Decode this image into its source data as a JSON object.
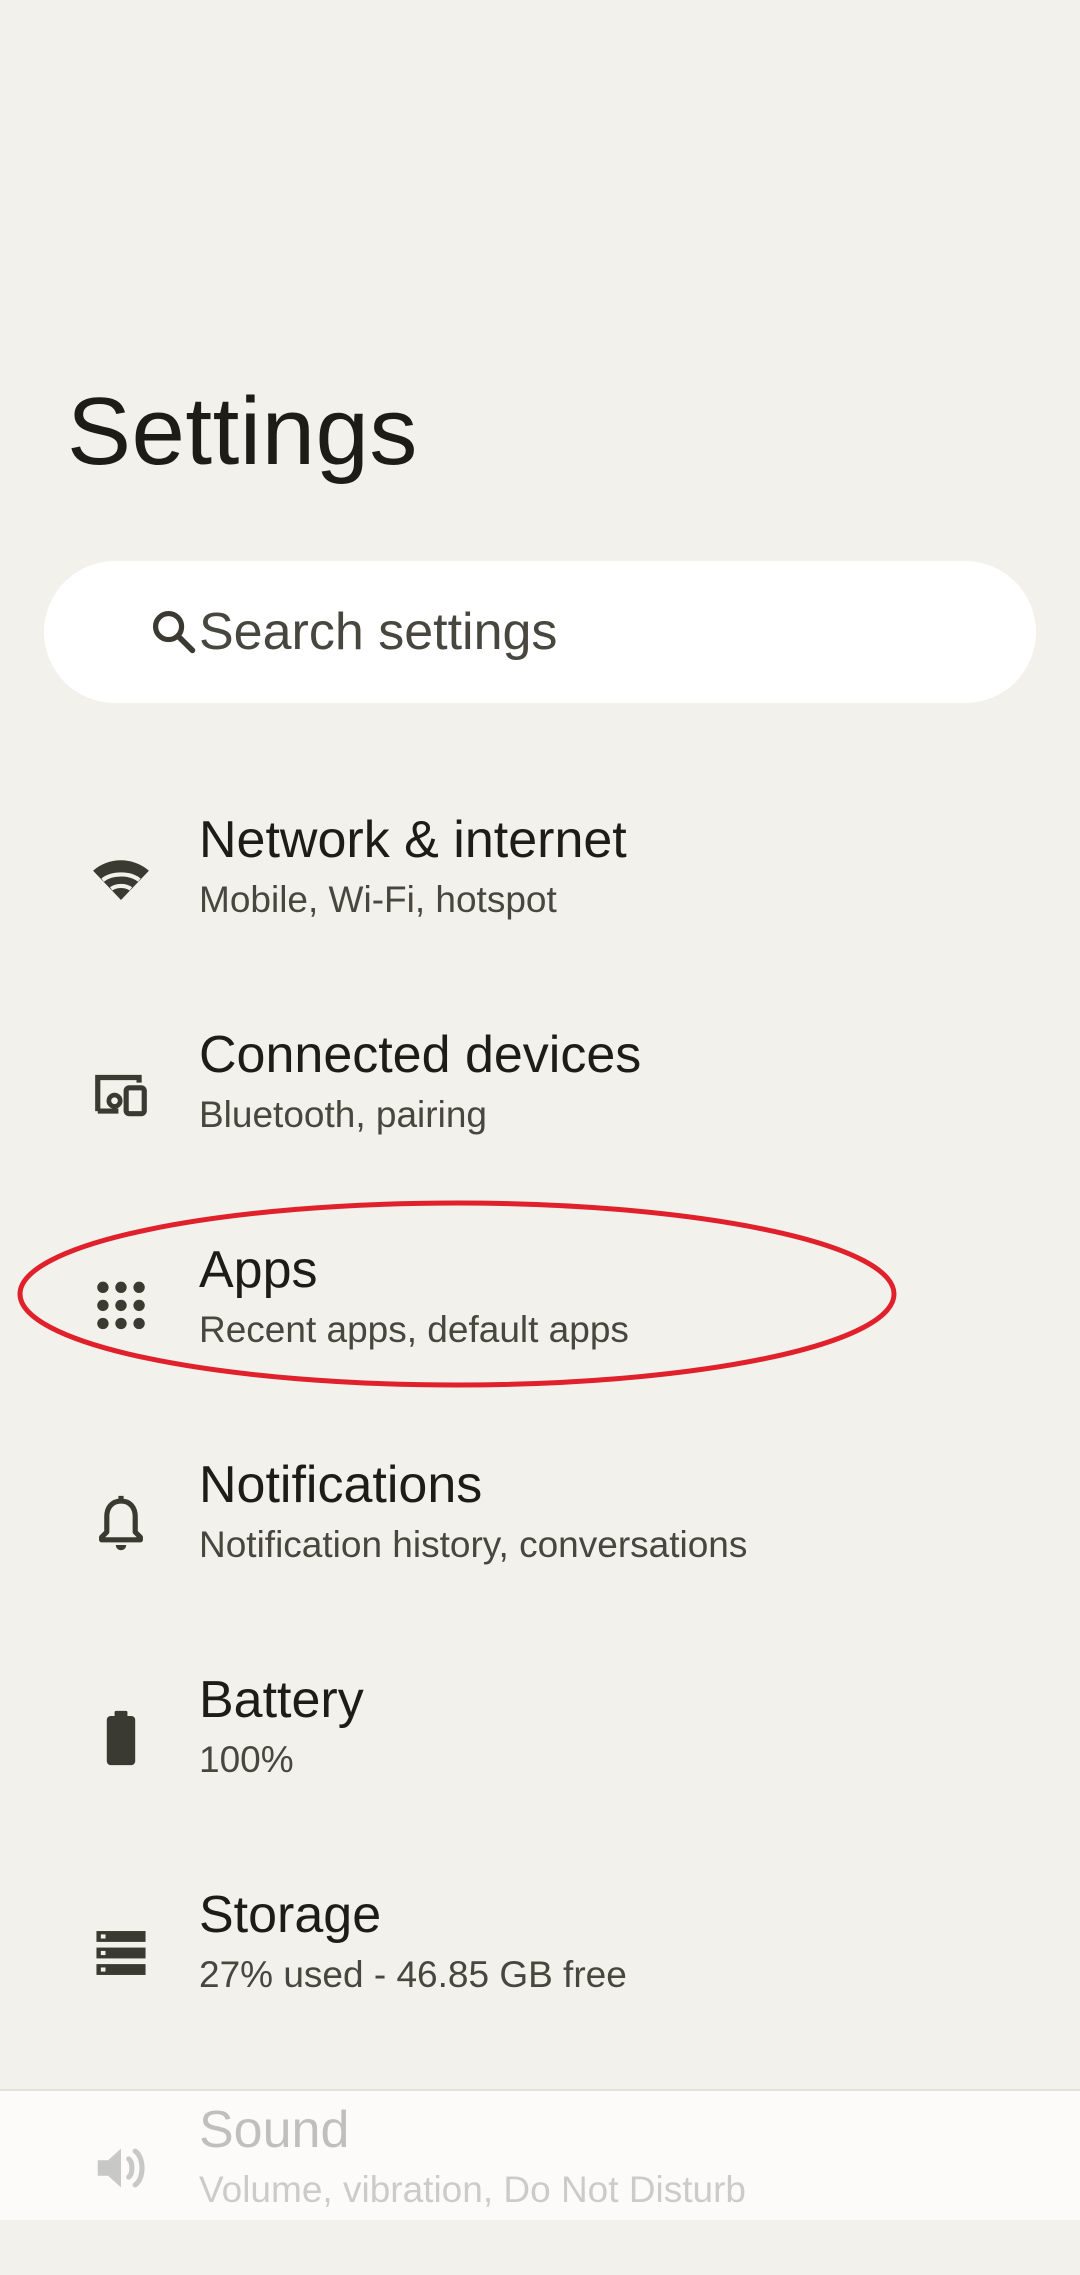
{
  "page": {
    "title": "Settings"
  },
  "search": {
    "placeholder": "Search settings",
    "icon": "search-icon"
  },
  "settings_items": [
    {
      "title": "Network & internet",
      "summary": "Mobile, Wi-Fi, hotspot",
      "icon": "wifi-icon"
    },
    {
      "title": "Connected devices",
      "summary": "Bluetooth, pairing",
      "icon": "connected-devices-icon"
    },
    {
      "title": "Apps",
      "summary": "Recent apps, default apps",
      "icon": "apps-grid-icon"
    },
    {
      "title": "Notifications",
      "summary": "Notification history, conversations",
      "icon": "bell-icon"
    },
    {
      "title": "Battery",
      "summary": "100%",
      "icon": "battery-icon"
    },
    {
      "title": "Storage",
      "summary": "27% used - 46.85 GB free",
      "icon": "storage-icon"
    },
    {
      "title": "Sound",
      "summary": "Volume, vibration, Do Not Disturb",
      "icon": "volume-icon"
    }
  ],
  "colors": {
    "background": "#f2f1eb",
    "search_background": "#ffffff",
    "primary_text": "#1d1c16",
    "secondary_text": "#47463f",
    "icon": "#3a3a33",
    "highlight_annotation": "#e0202a"
  }
}
